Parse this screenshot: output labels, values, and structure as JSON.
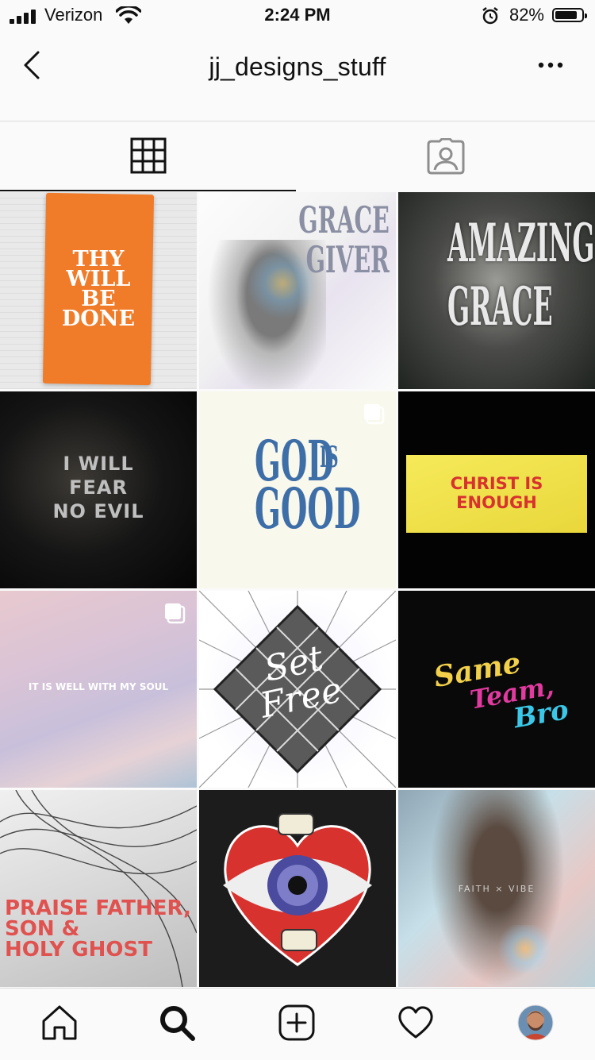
{
  "status_bar": {
    "carrier": "Verizon",
    "time": "2:24 PM",
    "battery_percent": "82%",
    "battery_level": 0.82,
    "icons": [
      "signal-icon",
      "wifi-icon",
      "alarm-icon",
      "battery-icon"
    ]
  },
  "header": {
    "title": "jj_designs_stuff",
    "back_icon": "chevron-left-icon",
    "more_icon": "more-dots-icon"
  },
  "tabs": [
    {
      "name": "grid",
      "icon": "grid-icon",
      "active": true
    },
    {
      "name": "tagged",
      "icon": "tagged-person-icon",
      "active": false
    }
  ],
  "posts": [
    {
      "text": "THY\nWILL\nBE\nDONE",
      "lines": [
        "THY",
        "WILL",
        "BE",
        "DONE"
      ],
      "multi": false
    },
    {
      "lines": [
        "GRACE",
        "GIVER"
      ],
      "multi": false
    },
    {
      "lines": [
        "AMAZING",
        "GRACE"
      ],
      "multi": false
    },
    {
      "lines": [
        "I WILL",
        "FEAR",
        "NO EVIL"
      ],
      "multi": false
    },
    {
      "lines": [
        "GOD",
        "IS",
        "GOOD"
      ],
      "multi": true
    },
    {
      "lines": [
        "CHRIST IS",
        "ENOUGH"
      ],
      "multi": false
    },
    {
      "lines": [
        "IT IS WELL WITH MY SOUL"
      ],
      "multi": true
    },
    {
      "lines": [
        "Set",
        "Free"
      ],
      "multi": false
    },
    {
      "lines": [
        "Same",
        "Team,",
        "Bro"
      ],
      "multi": false
    },
    {
      "lines": [
        "PRAISE FATHER,",
        "SON &",
        "HOLY GHOST"
      ],
      "multi": false
    },
    {
      "lines": [],
      "multi": false
    },
    {
      "lines": [
        "FAITH × VIBE"
      ],
      "multi": false
    }
  ],
  "bottom_nav": [
    {
      "name": "home",
      "icon": "home-icon"
    },
    {
      "name": "search",
      "icon": "search-icon",
      "active": true
    },
    {
      "name": "new-post",
      "icon": "plus-square-icon"
    },
    {
      "name": "activity",
      "icon": "heart-icon"
    },
    {
      "name": "profile",
      "icon": "avatar-icon"
    }
  ],
  "colors": {
    "orange": "#f07c2a",
    "yellow": "#f2e44a",
    "heart_red": "#d8322f"
  }
}
